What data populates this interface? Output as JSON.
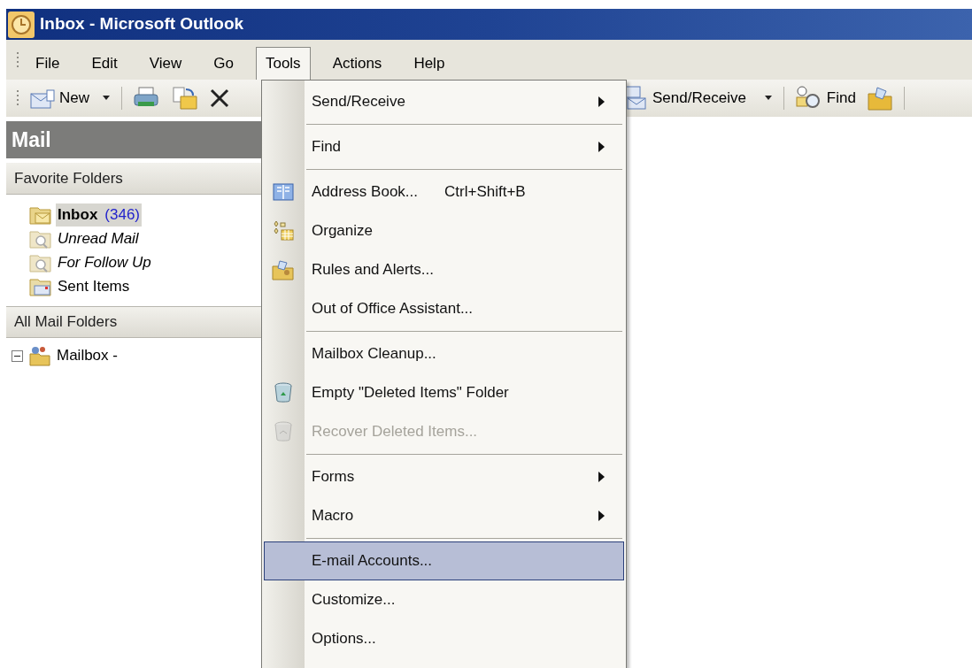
{
  "window": {
    "title": "Inbox - Microsoft Outlook"
  },
  "menu_bar": [
    {
      "label": "File",
      "selected": false
    },
    {
      "label": "Edit",
      "selected": false
    },
    {
      "label": "View",
      "selected": false
    },
    {
      "label": "Go",
      "selected": false
    },
    {
      "label": "Tools",
      "selected": true
    },
    {
      "label": "Actions",
      "selected": false
    },
    {
      "label": "Help",
      "selected": false
    }
  ],
  "toolbar": [
    {
      "label": "New",
      "dropdown": true
    },
    {
      "label": "Send/Receive",
      "dropdown": true
    },
    {
      "label": "Find",
      "dropdown": false
    }
  ],
  "sidebar": {
    "title": "Mail",
    "favorites": {
      "title": "Favorite Folders",
      "folders": [
        {
          "kind": "inbox",
          "name": "Inbox",
          "count": "(346)",
          "selected": true
        },
        {
          "kind": "search",
          "name": "Unread Mail",
          "selected": false
        },
        {
          "kind": "search",
          "name": "For Follow Up",
          "selected": false
        },
        {
          "kind": "sent",
          "name": "Sent Items",
          "selected": false
        }
      ]
    },
    "all_folders": {
      "title": "All Mail Folders",
      "tree": [
        {
          "name": "Mailbox -",
          "expanded": true
        }
      ]
    }
  },
  "tools_menu": [
    {
      "label": "Send/Receive",
      "submenu": true,
      "separator_before": false,
      "disabled": false,
      "selected": false
    },
    {
      "label": "Find",
      "submenu": true,
      "separator_before": true,
      "disabled": false,
      "selected": false
    },
    {
      "label": "Address Book...",
      "shortcut": "Ctrl+Shift+B",
      "submenu": false,
      "separator_before": true,
      "disabled": false,
      "selected": false
    },
    {
      "label": "Organize",
      "submenu": false,
      "separator_before": false,
      "disabled": false,
      "selected": false
    },
    {
      "label": "Rules and Alerts...",
      "submenu": false,
      "separator_before": false,
      "disabled": false,
      "selected": false
    },
    {
      "label": "Out of Office Assistant...",
      "submenu": false,
      "separator_before": false,
      "disabled": false,
      "selected": false
    },
    {
      "label": "Mailbox Cleanup...",
      "submenu": false,
      "separator_before": true,
      "disabled": false,
      "selected": false
    },
    {
      "label": "Empty \"Deleted Items\" Folder",
      "submenu": false,
      "separator_before": false,
      "disabled": false,
      "selected": false
    },
    {
      "label": "Recover Deleted Items...",
      "submenu": false,
      "separator_before": false,
      "disabled": true,
      "selected": false
    },
    {
      "label": "Forms",
      "submenu": true,
      "separator_before": true,
      "disabled": false,
      "selected": false
    },
    {
      "label": "Macro",
      "submenu": true,
      "separator_before": false,
      "disabled": false,
      "selected": false
    },
    {
      "label": "E-mail Accounts...",
      "submenu": false,
      "separator_before": true,
      "disabled": false,
      "selected": true
    },
    {
      "label": "Customize...",
      "submenu": false,
      "separator_before": false,
      "disabled": false,
      "selected": false
    },
    {
      "label": "Options...",
      "submenu": false,
      "separator_before": false,
      "disabled": false,
      "selected": false
    }
  ]
}
